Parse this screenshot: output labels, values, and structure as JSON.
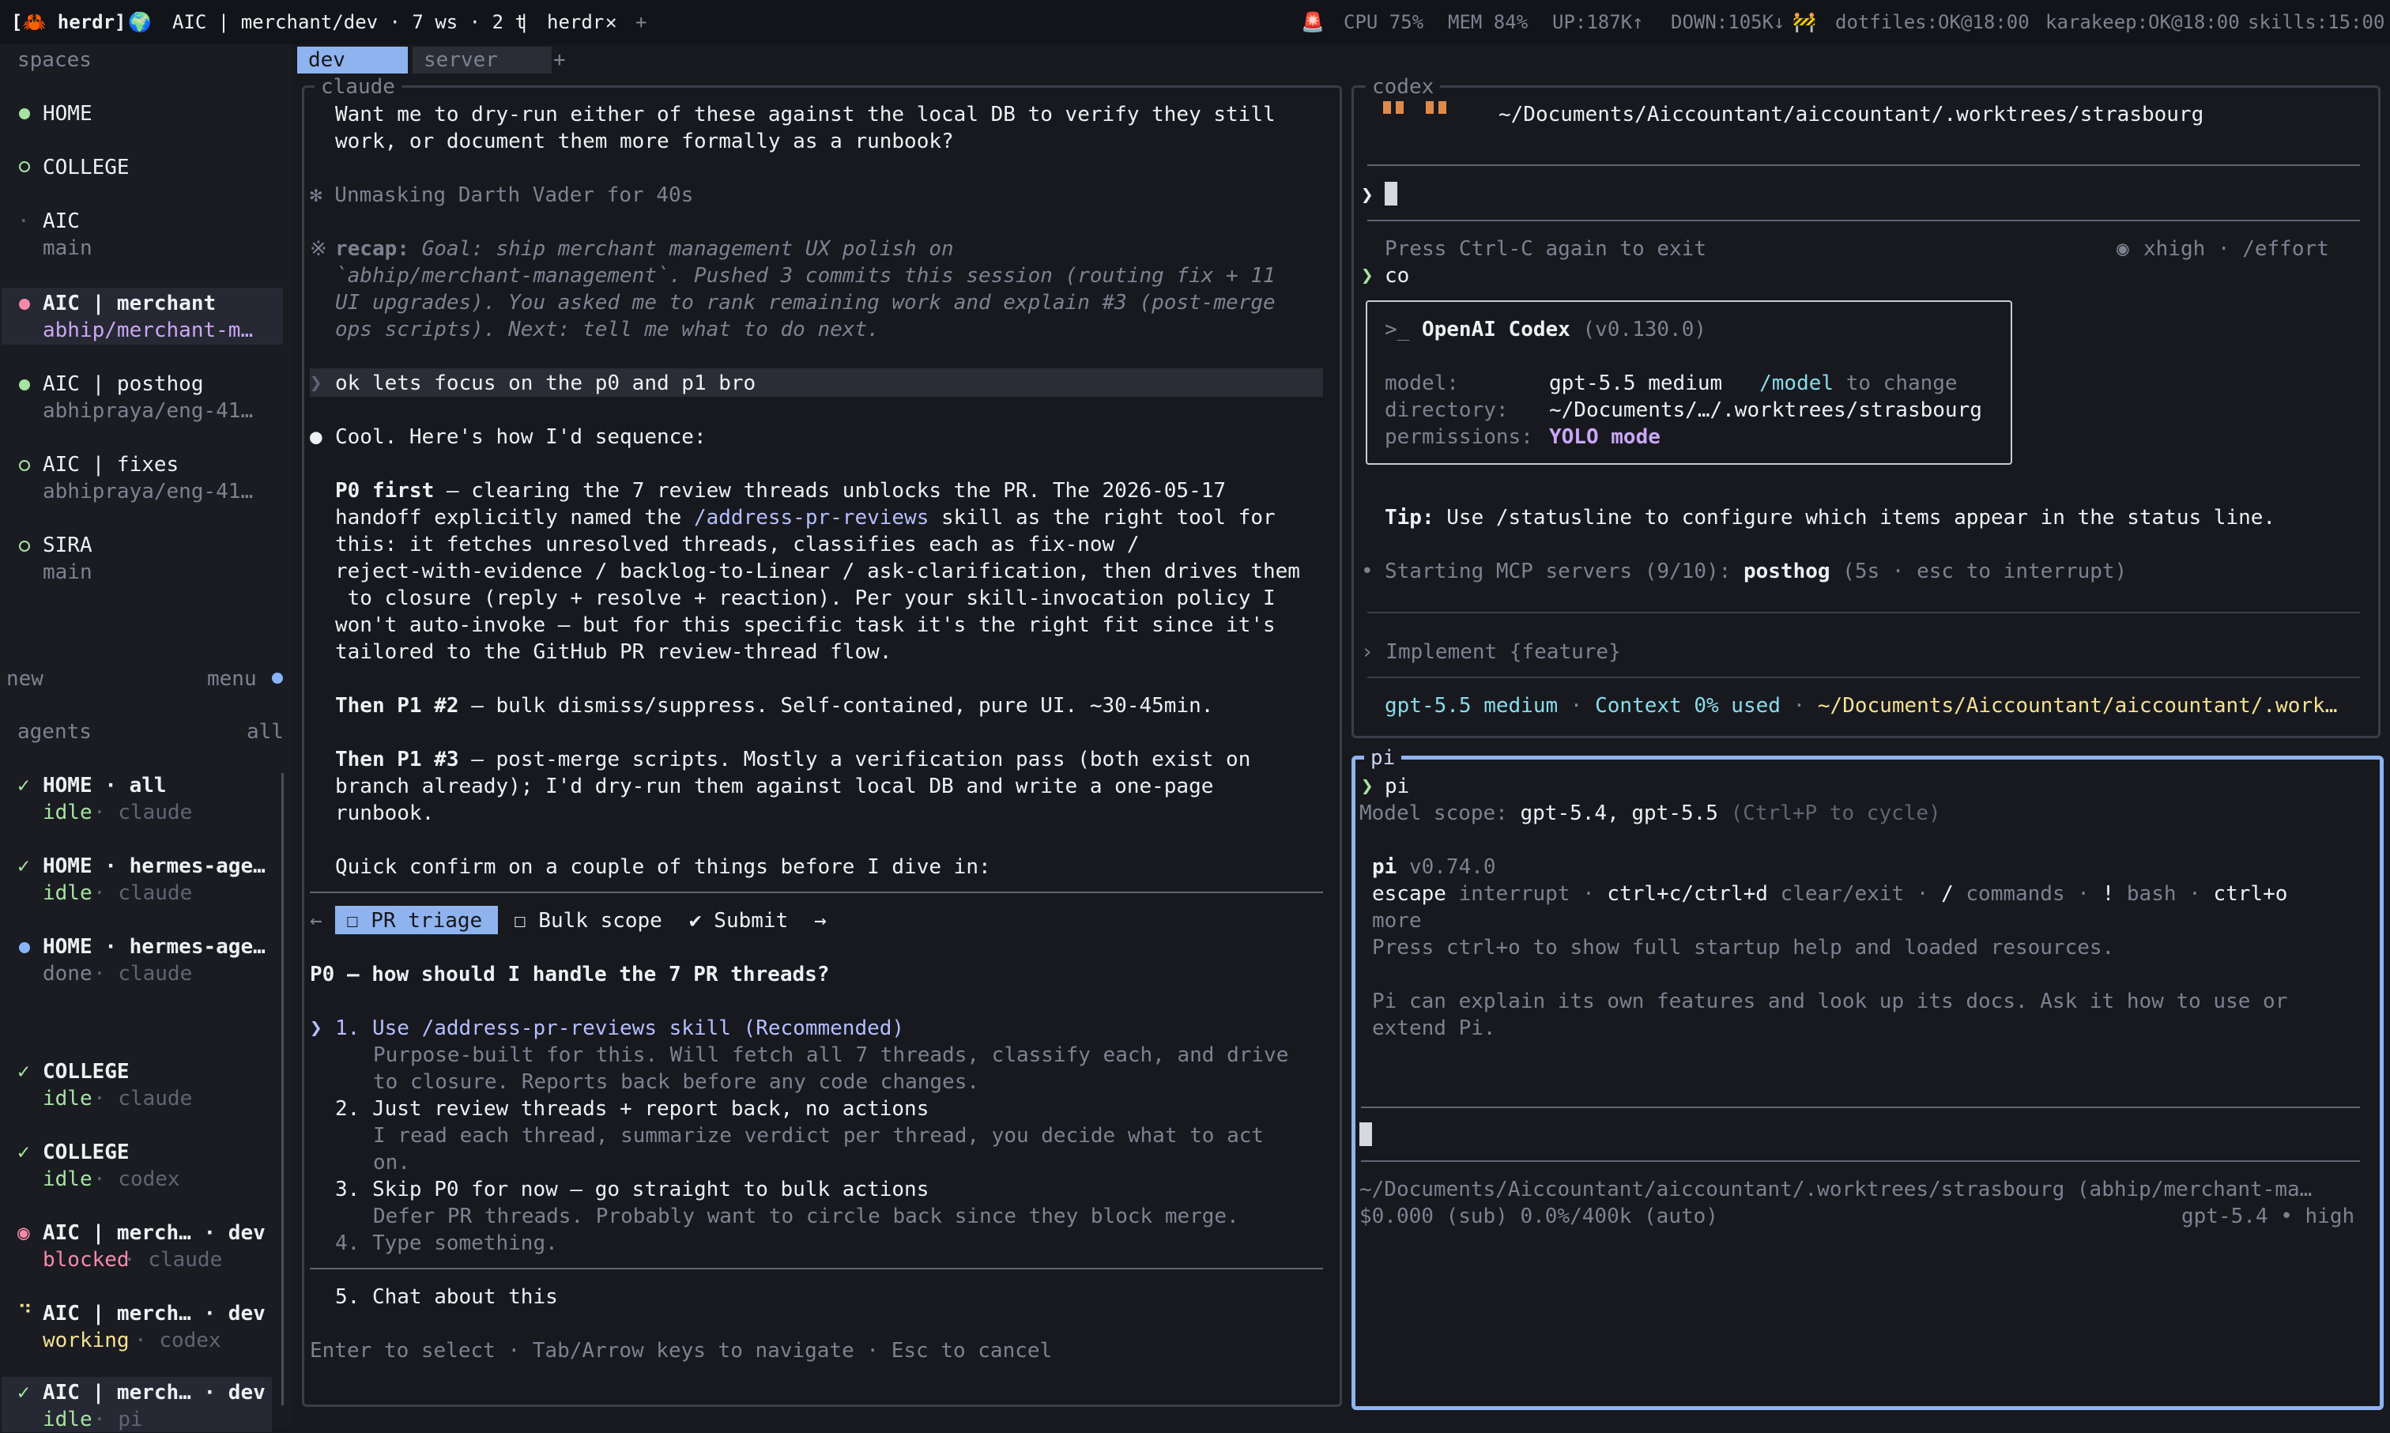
{
  "topbar": {
    "app": "[🦀 herdr]",
    "globe": "🌍",
    "workspace": "AIC | merchant/dev · 7 ws · 2 t",
    "sep": "|",
    "tab_name": "herdr",
    "close": "✕",
    "add": "+",
    "stop_icon": "🚨",
    "cpu": "CPU 75%",
    "mem": "MEM 84%",
    "up": "UP:187K↑",
    "down": "DOWN:105K↓",
    "construction_icon": "🚧",
    "dotfiles": "dotfiles:OK@18:00",
    "karakeep": "karakeep:OK@18:00",
    "skills": "skills:15:00"
  },
  "sidebar": {
    "spaces_label": "spaces",
    "spaces": [
      {
        "name": "HOME",
        "sub": "",
        "status": "active"
      },
      {
        "name": "COLLEGE",
        "sub": "",
        "status": "ring"
      },
      {
        "name": "AIC",
        "sub": "main",
        "status": "none"
      },
      {
        "name": "AIC | merchant",
        "sub": "abhip/merchant-m…",
        "status": "pink"
      },
      {
        "name": "AIC | posthog",
        "sub": "abhipraya/eng-41…",
        "status": "active"
      },
      {
        "name": "AIC | fixes",
        "sub": "abhipraya/eng-41…",
        "status": "ring"
      },
      {
        "name": "SIRA",
        "sub": "main",
        "status": "ring"
      }
    ],
    "new_label": "new",
    "menu_label": "menu",
    "agents_label": "agents",
    "all_label": "all",
    "agents": [
      {
        "mark": "✓",
        "name": "HOME · all",
        "state": "idle",
        "tool": "claude"
      },
      {
        "mark": "✓",
        "name": "HOME · hermes-age…",
        "state": "idle",
        "tool": "claude"
      },
      {
        "mark": "●",
        "name": "HOME · hermes-age…",
        "state": "done",
        "tool": "claude"
      },
      {
        "mark": "✓",
        "name": "COLLEGE",
        "state": "idle",
        "tool": "claude"
      },
      {
        "mark": "✓",
        "name": "COLLEGE",
        "state": "idle",
        "tool": "codex"
      },
      {
        "mark": "◉",
        "name": "AIC | merch… · dev",
        "state": "blocked",
        "tool": "claude"
      },
      {
        "mark": "⠙",
        "name": "AIC | merch… · dev",
        "state": "working",
        "tool": "codex"
      },
      {
        "mark": "✓",
        "name": "AIC | merch… · dev",
        "state": "idle",
        "tool": "pi"
      }
    ]
  },
  "tabs": {
    "dev": "dev",
    "server": "server",
    "add": "+"
  },
  "claude": {
    "title": "claude",
    "intro1": "Want me to dry-run either of these against the local DB to verify they still",
    "intro2": "work, or document them more formally as a runbook?",
    "spinner": "✻ Unmasking Darth Vader for 40s",
    "recap_mark": "※",
    "recap_label": "recap:",
    "recap1": " Goal: ship merchant management UX polish on",
    "recap2": "`abhip/merchant-management`. Pushed 3 commits this session (routing fix + 11",
    "recap3": "UI upgrades). You asked me to rank remaining work and explain #3 (post-merge",
    "recap4": "ops scripts). Next: tell me what to do next.",
    "user_prompt": "ok lets focus on the p0 and p1 bro",
    "reply_head": "Cool. Here's how I'd sequence:",
    "p0_label": "P0 first",
    "p0_1": " — clearing the 7 review threads unblocks the PR. The 2026-05-17",
    "p0_2a": "handoff explicitly named the ",
    "p0_2b": "/address-pr-reviews",
    "p0_2c": " skill as the right tool for",
    "p0_3": "this: it fetches unresolved threads, classifies each as fix-now /",
    "p0_4": "reject-with-evidence / backlog-to-Linear / ask-clarification, then drives them",
    "p0_5": " to closure (reply + resolve + reaction). Per your skill-invocation policy I",
    "p0_6": "won't auto-invoke — but for this specific task it's the right fit since it's",
    "p0_7": "tailored to the GitHub PR review-thread flow.",
    "p12_label": "Then P1 #2",
    "p12": " — bulk dismiss/suppress. Self-contained, pure UI. ~30-45min.",
    "p13_label": "Then P1 #3",
    "p13_1": " — post-merge scripts. Mostly a verification pass (both exist on",
    "p13_2": "branch already); I'd dry-run them against local DB and write a one-page",
    "p13_3": "runbook.",
    "confirm": "Quick confirm on a couple of things before I dive in:",
    "nav_left": "←",
    "tab_pr": "☐ PR triage",
    "tab_bulk": "☐ Bulk scope",
    "tab_submit": "✔ Submit",
    "nav_right": "→",
    "question": "P0 — how should I handle the 7 PR threads?",
    "options": [
      {
        "label": "1. Use /address-pr-reviews skill (Recommended)",
        "desc1": "Purpose-built for this. Will fetch all 7 threads, classify each, and drive",
        "desc2": "to closure. Reports back before any code changes."
      },
      {
        "label": "2. Just review threads + report back, no actions",
        "desc1": "I read each thread, summarize verdict per thread, you decide what to act",
        "desc2": "on."
      },
      {
        "label": "3. Skip P0 for now — go straight to bulk actions",
        "desc1": "Defer PR threads. Probably want to circle back since they block merge.",
        "desc2": ""
      },
      {
        "label": "4. Type something.",
        "desc1": "",
        "desc2": ""
      }
    ],
    "selector": "❯",
    "option5": "5. Chat about this",
    "footer": "Enter to select · Tab/Arrow keys to navigate · Esc to cancel"
  },
  "codex": {
    "title": "codex",
    "path": "~/Documents/Aiccountant/aiccountant/.worktrees/strasbourg",
    "prompt": "❯",
    "ctrlc": "Press Ctrl-C again to exit",
    "effort_icon": "◉",
    "effort": "xhigh · /effort",
    "typed_prompt": "❯",
    "typed": "co",
    "box_head": ">_ ",
    "box_name": "OpenAI Codex",
    "box_ver": " (v0.130.0)",
    "model_label": "model:",
    "model_val": "gpt-5.5 medium",
    "model_hint_cmd": "/model",
    "model_hint": " to change",
    "dir_label": "directory:",
    "dir_val": "~/Documents/…/.worktrees/strasbourg",
    "perm_label": "permissions:",
    "perm_val": "YOLO mode",
    "tip_label": "Tip:",
    "tip": " Use /statusline to configure which items appear in the status line.",
    "mcp_bullet": "•",
    "mcp_1": "Starting MCP servers (9/10): ",
    "mcp_2": "posthog",
    "mcp_3": " (5s · esc to interrupt)",
    "impl": "› Implement {feature}",
    "status_model": "gpt-5.5 medium",
    "status_sep": " · ",
    "status_ctx": "Context 0% used",
    "status_path": "~/Documents/Aiccountant/aiccountant/.work…"
  },
  "pi": {
    "title": "pi",
    "prompt": "❯",
    "cmd": "pi",
    "scope_label": "Model scope: ",
    "scope": "gpt-5.4, gpt-5.5",
    "scope_hint": " (Ctrl+P to cycle)",
    "name": "pi",
    "version": " v0.74.0",
    "keys_1a": "escape",
    "keys_1b": " interrupt · ",
    "keys_1c": "ctrl+c/ctrl+d",
    "keys_1d": " clear/exit · ",
    "keys_1e": "/",
    "keys_1f": " commands · ",
    "keys_1g": "!",
    "keys_1h": " bash · ",
    "keys_1i": "ctrl+o",
    "keys_2": "more",
    "help": "Press ctrl+o to show full startup help and loaded resources.",
    "explain1": "Pi can explain its own features and look up its docs. Ask it how to use or",
    "explain2": "extend Pi.",
    "footer_path": "~/Documents/Aiccountant/aiccountant/.worktrees/strasbourg (abhip/merchant-ma…",
    "cost": "$0.000 (sub) 0.0%/400k (auto)",
    "model": "gpt-5.4 • high"
  },
  "colors": {
    "accent_blue": "#8fb3ef",
    "green": "#a6e3a1",
    "pink": "#f38ba8",
    "yellow": "#f5e08f"
  }
}
